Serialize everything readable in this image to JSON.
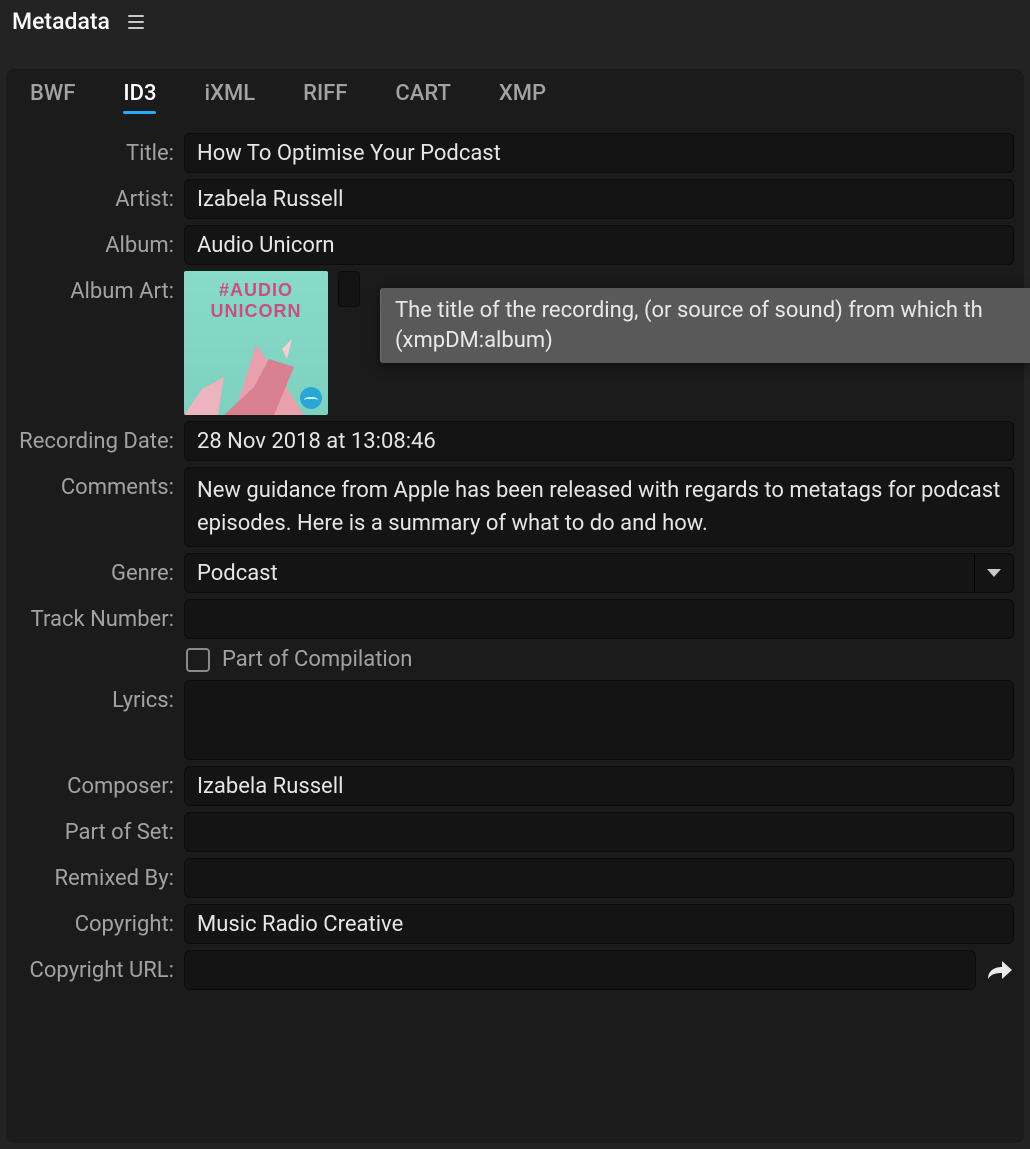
{
  "panel": {
    "title": "Metadata"
  },
  "tabs": {
    "items": [
      "BWF",
      "ID3",
      "iXML",
      "RIFF",
      "CART",
      "XMP"
    ],
    "activeIndex": 1
  },
  "labels": {
    "title": "Title:",
    "artist": "Artist:",
    "album": "Album:",
    "albumArt": "Album Art:",
    "recordingDate": "Recording Date:",
    "comments": "Comments:",
    "genre": "Genre:",
    "trackNumber": "Track Number:",
    "partOfCompilation": "Part of Compilation",
    "lyrics": "Lyrics:",
    "composer": "Composer:",
    "partOfSet": "Part of Set:",
    "remixedBy": "Remixed By:",
    "copyright": "Copyright:",
    "copyrightUrl": "Copyright URL:"
  },
  "fields": {
    "title": "How To Optimise Your Podcast",
    "artist": "Izabela Russell",
    "album": "Audio Unicorn",
    "recordingDate": "28 Nov 2018 at 13:08:46",
    "comments": "New guidance from Apple has been released with regards to metatags for podcast episodes. Here is a summary of what to do and how.",
    "genre": "Podcast",
    "trackNumber": "",
    "partOfCompilation": false,
    "lyrics": "",
    "composer": "Izabela Russell",
    "partOfSet": "",
    "remixedBy": "",
    "copyright": "Music Radio Creative",
    "copyrightUrl": ""
  },
  "albumArt": {
    "line1": "#AUDIO",
    "line2": "UNICORN"
  },
  "tooltip": "The title of the recording, (or source of sound) from which th\n(xmpDM:album)"
}
